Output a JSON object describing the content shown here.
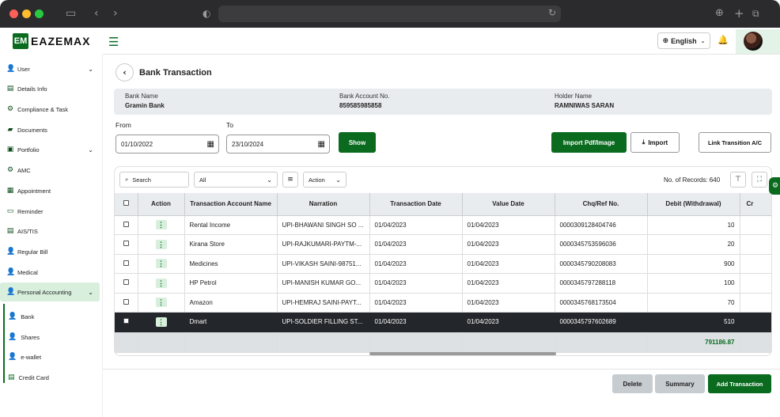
{
  "app": {
    "brand": "EAZEMAX",
    "brand_mark": "EM",
    "language": "English",
    "page_title": "Bank Transaction"
  },
  "sidebar": {
    "items": [
      {
        "label": "User",
        "icon": "user-icon",
        "has_chevron": true
      },
      {
        "label": "Details Info",
        "icon": "id-card-icon"
      },
      {
        "label": "Compliance & Task",
        "icon": "users-cog-icon"
      },
      {
        "label": "Documents",
        "icon": "folder-icon"
      },
      {
        "label": "Portfolio",
        "icon": "briefcase-icon",
        "has_chevron": true
      },
      {
        "label": "AMC",
        "icon": "cog-icon"
      },
      {
        "label": "Appointment",
        "icon": "calendar-icon"
      },
      {
        "label": "Reminder",
        "icon": "reminder-icon"
      },
      {
        "label": "AIS/TIS",
        "icon": "document-icon"
      },
      {
        "label": "Regular Bill",
        "icon": "bill-icon"
      },
      {
        "label": "Medical",
        "icon": "medical-icon"
      },
      {
        "label": "Personal Accounting",
        "icon": "accounting-icon",
        "has_chevron": true,
        "active": true
      }
    ],
    "sub_items": [
      {
        "label": "Bank",
        "icon": "bank-icon"
      },
      {
        "label": "Shares",
        "icon": "shares-icon"
      },
      {
        "label": "e-wallet",
        "icon": "wallet-icon"
      },
      {
        "label": "Credit Card",
        "icon": "credit-card-icon"
      }
    ]
  },
  "account": {
    "bank_name_label": "Bank Name",
    "bank_name": "Gramin Bank",
    "account_no_label": "Bank Account No.",
    "account_no": "859585985858",
    "holder_label": "Holder Name",
    "holder_name": "RAMNIWAS SARAN"
  },
  "filters": {
    "from_label": "From",
    "from_value": "01/10/2022",
    "to_label": "To",
    "to_value": "23/10/2024",
    "show_label": "Show",
    "import_pdf_label": "Import Pdf/Image",
    "import_label": "Import",
    "link_label": "Link Transition A/C"
  },
  "table_toolbar": {
    "search_placeholder": "Search",
    "filter_select": "All",
    "action_select": "Action",
    "records_label": "No. of Records: 640"
  },
  "table": {
    "columns": [
      "Action",
      "Transaction Account Name",
      "Narration",
      "Transaction Date",
      "Value Date",
      "Chq/Ref No.",
      "Debit (Withdrawal)",
      "Cr"
    ],
    "rows": [
      {
        "account": "Rental Income",
        "narration": "UPI-BHAWANI SINGH SO ...",
        "txn_date": "01/04/2023",
        "value_date": "01/04/2023",
        "ref": "0000309128404746",
        "debit": "10"
      },
      {
        "account": "Kirana Store",
        "narration": "UPI-RAJKUMARI-PAYTM-...",
        "txn_date": "01/04/2023",
        "value_date": "01/04/2023",
        "ref": "0000345753596036",
        "debit": "20"
      },
      {
        "account": "Medicines",
        "narration": "UPI-VIKASH SAINI-98751...",
        "txn_date": "01/04/2023",
        "value_date": "01/04/2023",
        "ref": "0000345790208083",
        "debit": "900"
      },
      {
        "account": "HP Petrol",
        "narration": "UPI-MANISH KUMAR GO...",
        "txn_date": "01/04/2023",
        "value_date": "01/04/2023",
        "ref": "0000345797288118",
        "debit": "100"
      },
      {
        "account": "Amazon",
        "narration": "UPI-HEMRAJ SAINI-PAYT...",
        "txn_date": "01/04/2023",
        "value_date": "01/04/2023",
        "ref": "0000345768173504",
        "debit": "70"
      },
      {
        "account": "Dmart",
        "narration": "UPI-SOLDIER FILLING ST...",
        "txn_date": "01/04/2023",
        "value_date": "01/04/2023",
        "ref": "0000345797602689",
        "debit": "510",
        "selected": true
      }
    ],
    "total_debit": "791186.87"
  },
  "footer": {
    "delete_label": "Delete",
    "summary_label": "Summary",
    "add_label": "Add Transaction"
  },
  "colors": {
    "brand_green": "#0a6b1f",
    "active_bg": "#d8efdd",
    "selected_row": "#23272b",
    "total_green": "#0a6b1f"
  }
}
